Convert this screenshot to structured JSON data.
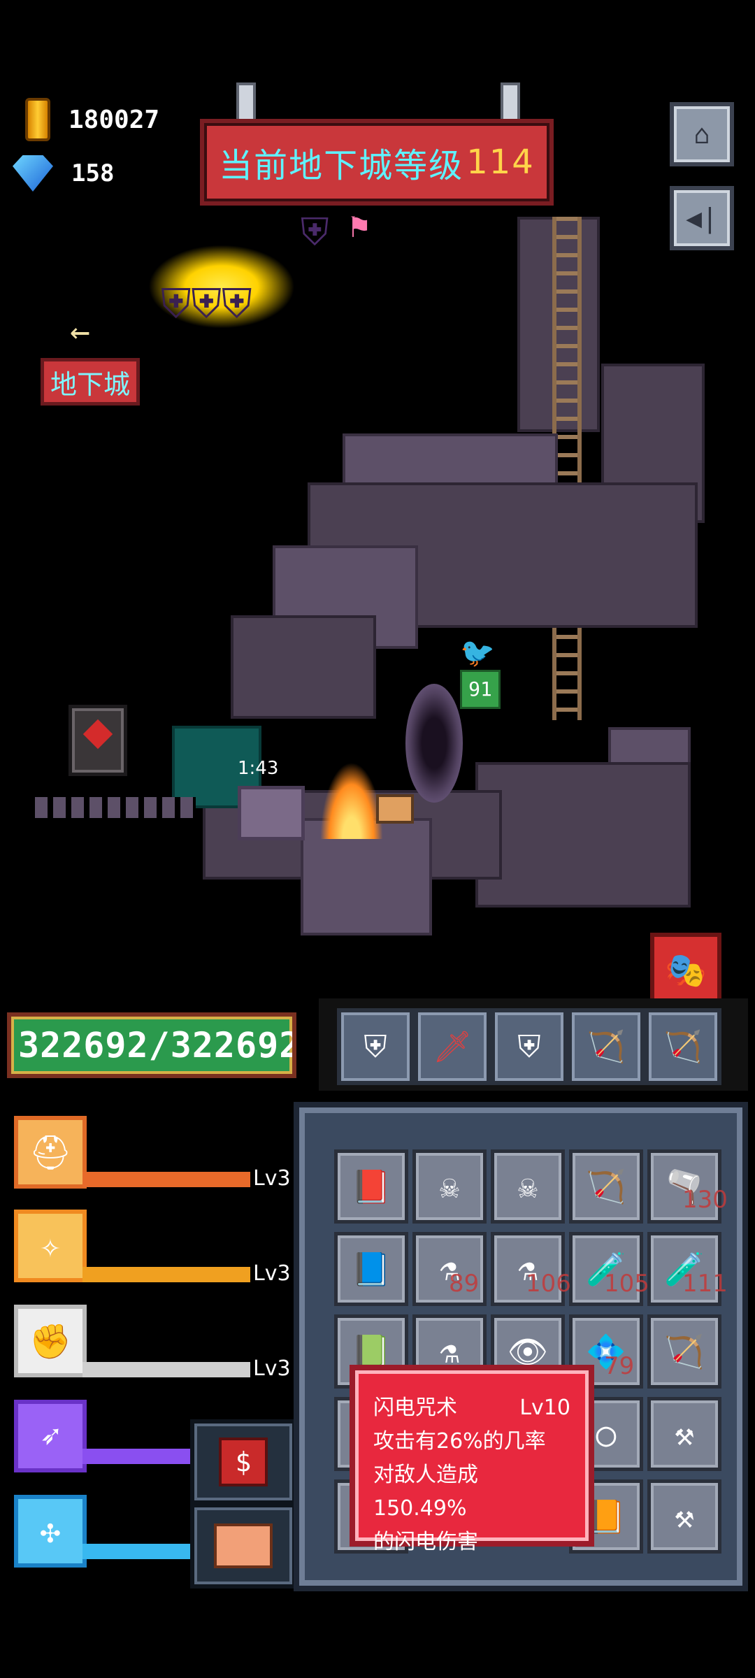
{
  "currency": {
    "gold": "180027",
    "gems": "158"
  },
  "banner": {
    "text": "当前地下城等级",
    "level": "114"
  },
  "dungeon_label": "地下城",
  "scene": {
    "timer": "1:43",
    "monster_level": "91"
  },
  "hp": {
    "text": "322692/322692"
  },
  "skills": [
    {
      "level_label": "Lv3",
      "color": "#e86a2a"
    },
    {
      "level_label": "Lv3",
      "color": "#f0a020"
    },
    {
      "level_label": "Lv3",
      "color": "#d0d0d0"
    },
    {
      "level_label": "",
      "color": "#8a4ff0"
    },
    {
      "level_label": "",
      "color": "#38b8f0"
    }
  ],
  "inventory_counts": [
    "130",
    "89",
    "106",
    "105",
    "111",
    "79"
  ],
  "tooltip": {
    "name": "闪电咒术",
    "level": "Lv10",
    "line1": "攻击有26%的几率",
    "line2": "对敌人造成150.49%",
    "line3": "的闪电伤害"
  },
  "buttons": {
    "shop_symbol": "$"
  },
  "icons": [
    "gold-coin-icon",
    "gem-icon",
    "home-icon",
    "sound-icon",
    "arrow-left-icon",
    "shield-icon",
    "sword-icon",
    "bow-icon",
    "jester-hat-icon",
    "chest-icon"
  ]
}
